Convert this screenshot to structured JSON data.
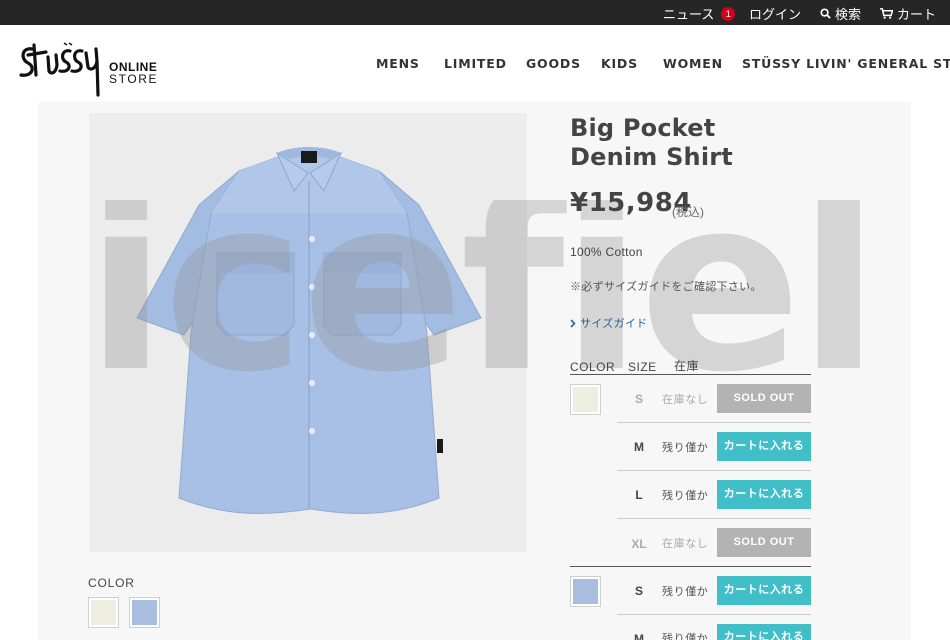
{
  "topbar": {
    "news_label": "ニュース",
    "news_count": "1",
    "login_label": "ログイン",
    "search_label": "検索",
    "cart_label": "カート"
  },
  "brand": {
    "online": "ONLINE",
    "store": "STORE"
  },
  "nav": [
    "MENS",
    "LIMITED",
    "GOODS",
    "KIDS",
    "WOMEN",
    "STÜSSY LIVIN' GENERAL STORE"
  ],
  "product": {
    "title": "Big Pocket Denim Shirt",
    "price": "¥15,984",
    "tax_note": "(税込)",
    "material": "100% Cotton",
    "size_note": "※必ずサイズガイドをご確認下さい。",
    "size_guide_label": "サイズガイド",
    "gallery_color_label": "COLOR"
  },
  "watermark": "icefield",
  "variant_table": {
    "headers": {
      "color": "COLOR",
      "size": "SIZE",
      "stock": "在庫"
    },
    "rows": [
      {
        "color_name": "cream",
        "color": "#eeeee0",
        "size": "S",
        "stock": "在庫なし",
        "available": false,
        "button": "SOLD OUT"
      },
      {
        "color_name": "cream",
        "color": "#eeeee0",
        "size": "M",
        "stock": "残り僅か",
        "available": true,
        "button": "カートに入れる"
      },
      {
        "color_name": "cream",
        "color": "#eeeee0",
        "size": "L",
        "stock": "残り僅か",
        "available": true,
        "button": "カートに入れる"
      },
      {
        "color_name": "cream",
        "color": "#eeeee0",
        "size": "XL",
        "stock": "在庫なし",
        "available": false,
        "button": "SOLD OUT"
      },
      {
        "color_name": "blue",
        "color": "#a9bde0",
        "size": "S",
        "stock": "残り僅か",
        "available": true,
        "button": "カートに入れる"
      },
      {
        "color_name": "blue",
        "color": "#a9bde0",
        "size": "M",
        "stock": "残り僅か",
        "available": true,
        "button": "カートに入れる"
      }
    ]
  },
  "colors": {
    "topbar": "#262626",
    "badge": "#d0021b",
    "cart_button": "#40bfc9",
    "sold_out_button": "#b3b3b3",
    "shirt": "#a7bfe3",
    "swatch_cream": "#eeeee0",
    "swatch_blue": "#a9bde0"
  }
}
